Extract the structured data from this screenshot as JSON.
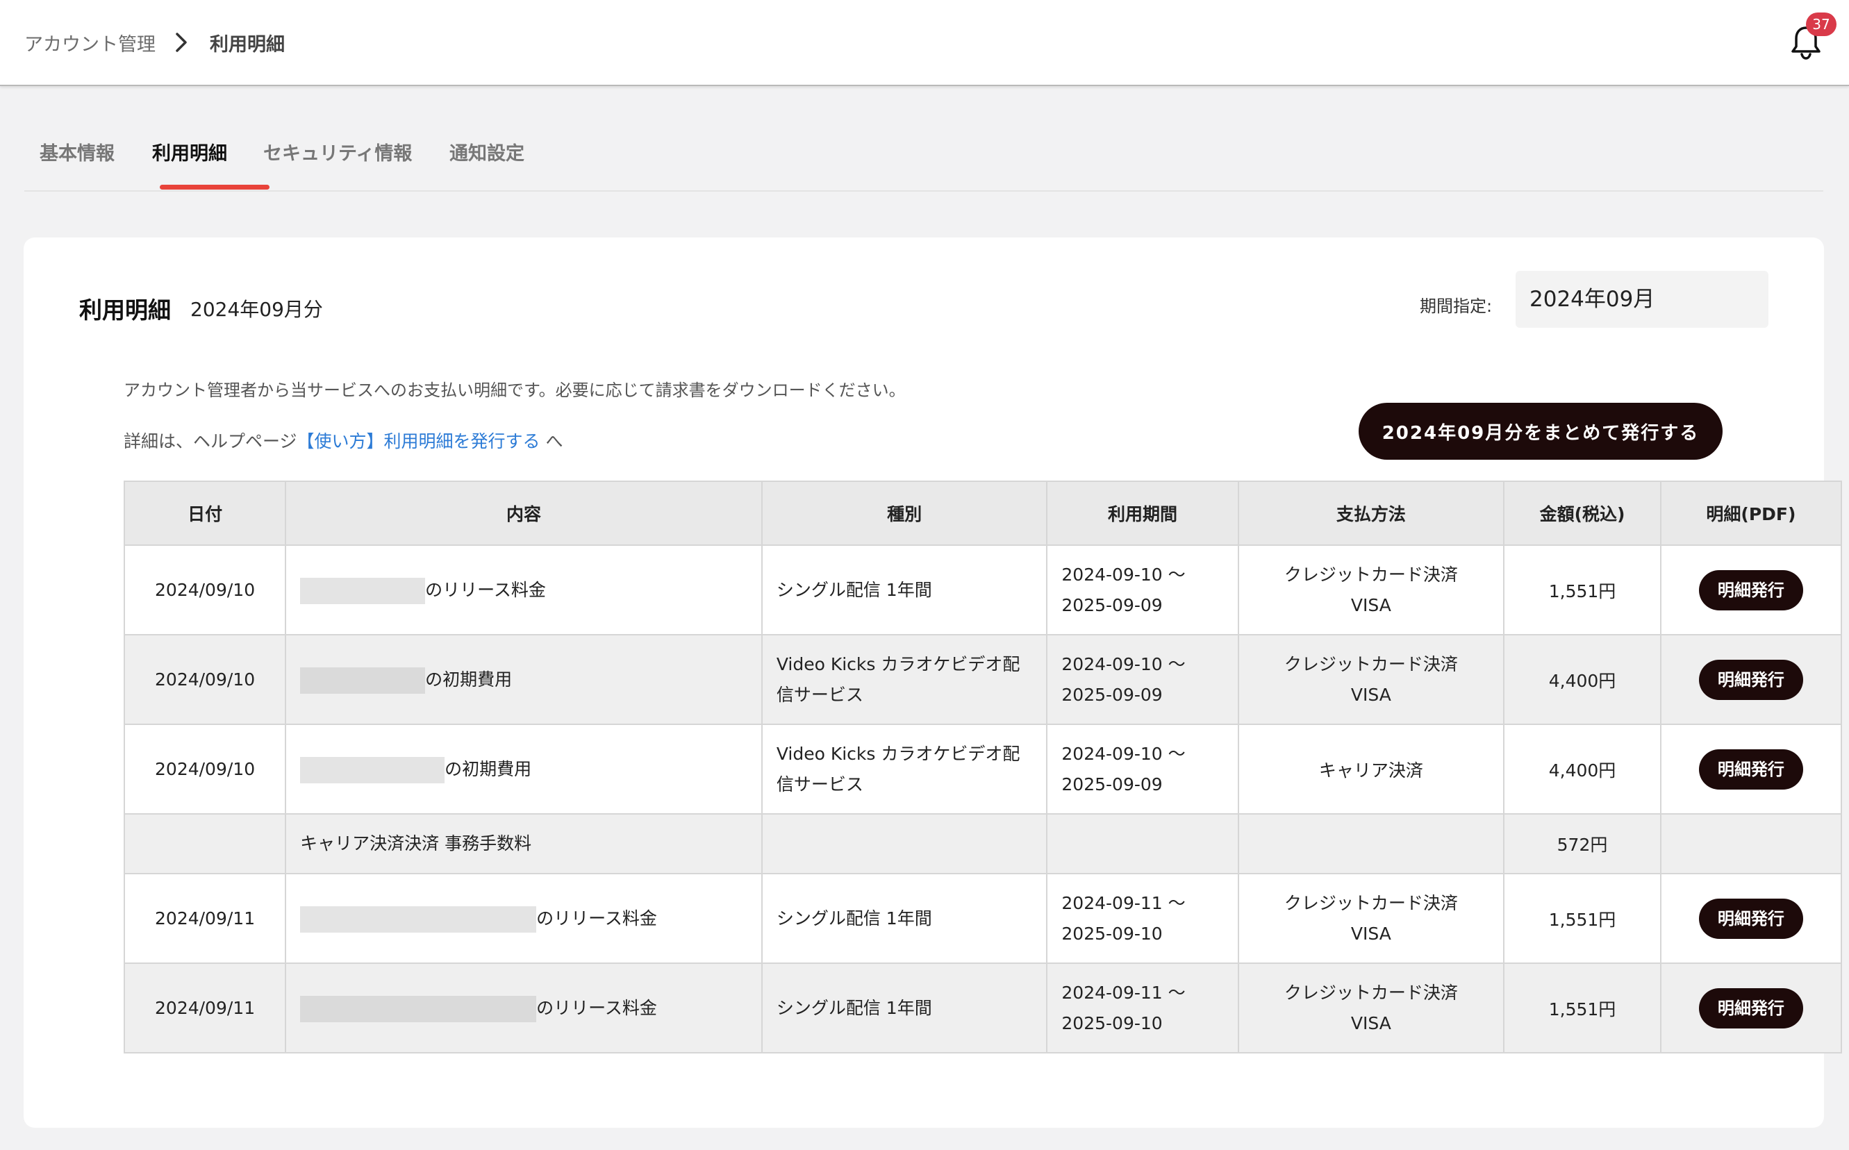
{
  "header": {
    "breadcrumb_root": "アカウント管理",
    "breadcrumb_current": "利用明細",
    "notification_count": "37"
  },
  "tabs": [
    {
      "label": "基本情報"
    },
    {
      "label": "利用明細"
    },
    {
      "label": "セキュリティ情報"
    },
    {
      "label": "通知設定"
    }
  ],
  "card": {
    "title": "利用明細",
    "month": "2024年09月分",
    "period_label": "期間指定:",
    "period_value": "2024年09月",
    "description": "アカウント管理者から当サービスへのお支払い明細です。必要に応じて請求書をダウンロードください。",
    "help_prefix": "詳細は、ヘルプページ",
    "help_link": "【使い方】利用明細を発行する",
    "help_suffix": " へ",
    "bulk_button": "2024年09月分をまとめて発行する"
  },
  "table": {
    "headers": [
      "日付",
      "内容",
      "種別",
      "利用期間",
      "支払方法",
      "金額(税込)",
      "明細(PDF)"
    ],
    "rows": [
      {
        "date": "2024/09/10",
        "content": "のリリース料金",
        "type": "シングル配信 1年間",
        "period_start": "2024-09-10 〜",
        "period_end": "2025-09-09",
        "payment": "クレジットカード決済",
        "payment_sub": "VISA",
        "amount": "1,551円",
        "button": "明細発行"
      },
      {
        "date": "2024/09/10",
        "content": "の初期費用",
        "type": "Video Kicks カラオケビデオ配信サービス",
        "period_start": "2024-09-10 〜",
        "period_end": "2025-09-09",
        "payment": "クレジットカード決済",
        "payment_sub": "VISA",
        "amount": "4,400円",
        "button": "明細発行"
      },
      {
        "date": "2024/09/10",
        "content": "の初期費用",
        "type": "Video Kicks カラオケビデオ配信サービス",
        "period_start": "2024-09-10 〜",
        "period_end": "2025-09-09",
        "payment": "キャリア決済",
        "payment_sub": "",
        "amount": "4,400円",
        "button": "明細発行"
      },
      {
        "date": "",
        "content": "キャリア決済決済 事務手数料",
        "type": "",
        "period_start": "",
        "period_end": "",
        "payment": "",
        "payment_sub": "",
        "amount": "572円",
        "button": ""
      },
      {
        "date": "2024/09/11",
        "content": "のリリース料金",
        "type": "シングル配信 1年間",
        "period_start": "2024-09-11 〜",
        "period_end": "2025-09-10",
        "payment": "クレジットカード決済",
        "payment_sub": "VISA",
        "amount": "1,551円",
        "button": "明細発行"
      },
      {
        "date": "2024/09/11",
        "content": "のリリース料金",
        "type": "シングル配信 1年間",
        "period_start": "2024-09-11 〜",
        "period_end": "2025-09-10",
        "payment": "クレジットカード決済",
        "payment_sub": "VISA",
        "amount": "1,551円",
        "button": "明細発行"
      }
    ]
  }
}
